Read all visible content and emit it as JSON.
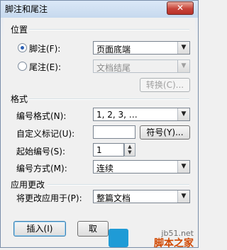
{
  "window": {
    "title": "脚注和尾注",
    "close_label": "✕"
  },
  "position_group": {
    "title": "位置",
    "footnote_label": "脚注(F):",
    "footnote_value": "页面底端",
    "endnote_label": "尾注(E):",
    "endnote_value": "文档结尾",
    "convert_label": "转换(C)...",
    "selected": "footnote"
  },
  "format_group": {
    "title": "格式",
    "number_format_label": "编号格式(N):",
    "number_format_value": "1, 2, 3, …",
    "custom_mark_label": "自定义标记(U):",
    "custom_mark_value": "",
    "symbol_button_label": "符号(Y)...",
    "start_at_label": "起始编号(S):",
    "start_at_value": "1",
    "numbering_label": "编号方式(M):",
    "numbering_value": "连续"
  },
  "apply_group": {
    "title": "应用更改",
    "apply_to_label": "将更改应用于(P):",
    "apply_to_value": "整篇文档"
  },
  "buttons": {
    "insert_label": "插入(I)",
    "cancel_label": "取"
  },
  "watermark": {
    "site": "jb51.net",
    "brand": "脚本之家"
  },
  "icons": {
    "dropdown": "chevron-down-icon",
    "spin": "spin-arrows-icon"
  }
}
